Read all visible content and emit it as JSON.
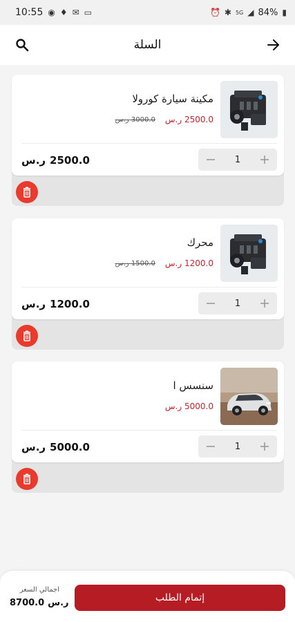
{
  "status_bar": {
    "time": "10:55",
    "battery": "84%",
    "signal_label": "5G"
  },
  "header": {
    "title": "السلة"
  },
  "currency": "ر.س",
  "cart_items": [
    {
      "name": "مكينة سيارة كورولا",
      "price": "2500.0",
      "old_price": "3000.0",
      "quantity": "1",
      "line_total": "2500.0",
      "image": "engine"
    },
    {
      "name": "محرك",
      "price": "1200.0",
      "old_price": "1500.0",
      "quantity": "1",
      "line_total": "1200.0",
      "image": "engine"
    },
    {
      "name": "سنسس ا",
      "price": "5000.0",
      "old_price": "",
      "quantity": "1",
      "line_total": "5000.0",
      "image": "car"
    }
  ],
  "footer": {
    "checkout_label": "إتمام الطلب",
    "total_label": "اجمالي السعر",
    "total_value": "8700.0"
  },
  "colors": {
    "accent": "#b61c24",
    "price": "#c8212b",
    "delete": "#e93a2e"
  }
}
